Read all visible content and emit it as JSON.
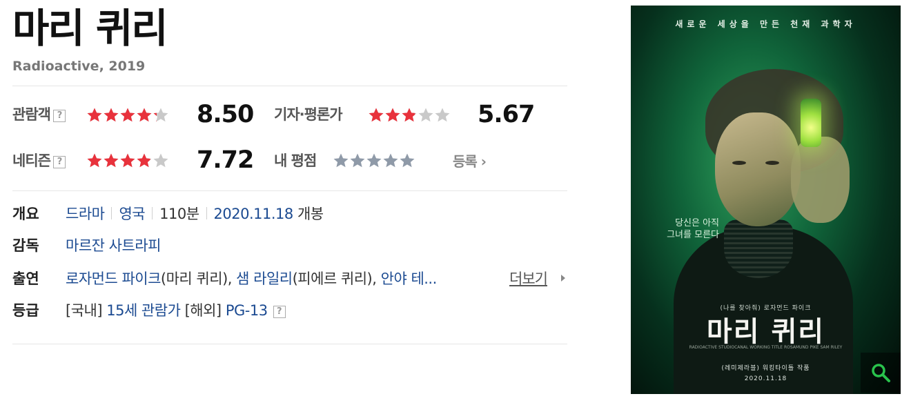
{
  "movie": {
    "title": "마리 퀴리",
    "subtitle": "Radioactive, 2019"
  },
  "ratings": {
    "audience": {
      "label": "관람객",
      "help": "?",
      "score": "8.50",
      "stars": 4.25
    },
    "critic": {
      "label": "기자·평론가",
      "score": "5.67",
      "stars": 2.85
    },
    "netizen": {
      "label": "네티즌",
      "help": "?",
      "score": "7.72",
      "stars": 3.86
    },
    "mine": {
      "label": "내 평점",
      "register": "등록",
      "stars": 0
    }
  },
  "info": {
    "summary": {
      "label": "개요",
      "genre": "드라마",
      "country": "영국",
      "runtime": "110분",
      "release_date": "2020.11.18",
      "release_suffix": "개봉"
    },
    "director": {
      "label": "감독",
      "name": "마르잔 사트라피"
    },
    "cast": {
      "label": "출연",
      "members": [
        {
          "actor": "로자먼드 파이크",
          "role": "(마리 퀴리)"
        },
        {
          "actor": "샘 라일리",
          "role": "(피에르 퀴리)"
        },
        {
          "actor": "안야 테..."
        }
      ],
      "separator": ", ",
      "more": "더보기"
    },
    "grade": {
      "label": "등급",
      "domestic_prefix": "[국내]",
      "domestic": "15세 관람가",
      "overseas_prefix": "[해외]",
      "overseas": "PG-13",
      "help": "?"
    }
  },
  "poster": {
    "tagline": "새로운 세상을 만든 천재 과학자",
    "quote_line1": "당신은 아직",
    "quote_line2": "그녀를 모른다",
    "credit": "(나를 찾아줘) 로자먼드 파이크",
    "title": "마리 퀴리",
    "fine_print": "RADIOACTIVE STUDIOCANAL WORKING TITLE ROSAMUND PIKE SAM RILEY",
    "production": "(레미제라블) 워킹타이틀 작품",
    "date": "2020.11.18"
  },
  "colors": {
    "star_filled": "#e8323c",
    "star_empty": "#c9c9c9",
    "star_mine": "#8f9aa8",
    "link": "#1b4a91"
  }
}
